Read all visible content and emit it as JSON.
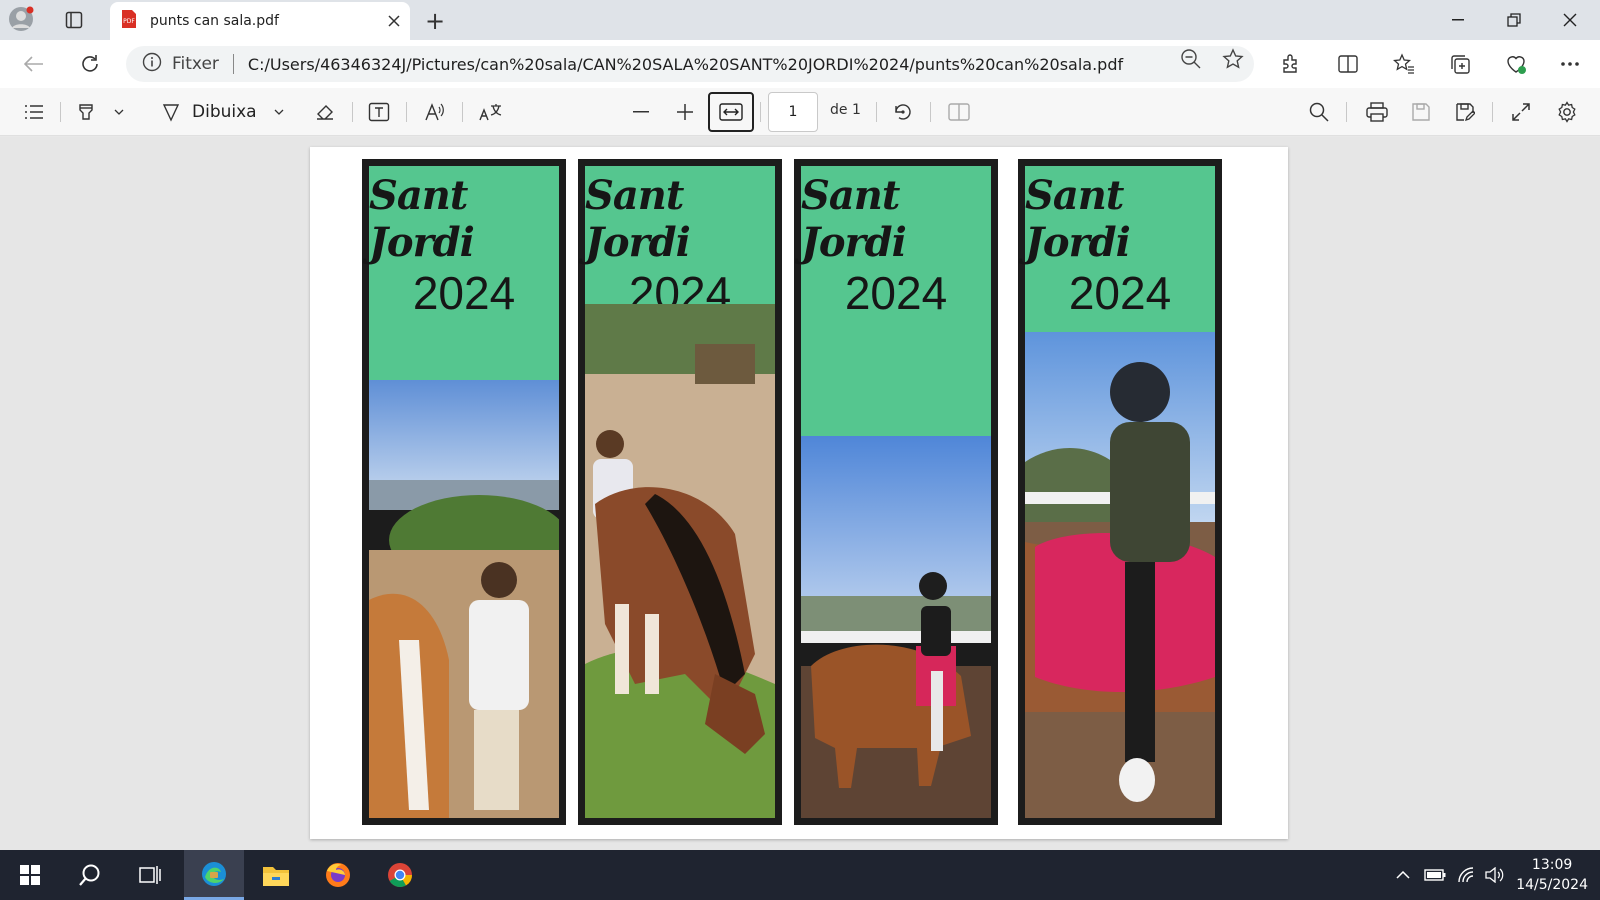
{
  "browser": {
    "tab_title": "punts can sala.pdf",
    "address_label": "Fitxer",
    "url": "C:/Users/46346324J/Pictures/can%20sala/CAN%20SALA%20SANT%20JORDI%2024/punts%20can%20sala.pdf"
  },
  "pdf_toolbar": {
    "draw_label": "Dibuixa",
    "page_number": "1",
    "page_of": "de 1"
  },
  "bookmarks": [
    {
      "title": "Sant Jordi",
      "year": "2024"
    },
    {
      "title": "Sant Jordi",
      "year": "2024"
    },
    {
      "title": "Sant Jordi",
      "year": "2024"
    },
    {
      "title": "Sant Jordi",
      "year": "2024"
    }
  ],
  "taskbar": {
    "time": "13:09",
    "date": "14/5/2024"
  },
  "colors": {
    "bookmark_green": "#55c68f",
    "bookmark_border": "#1c1c1c",
    "taskbar": "#1f2430"
  }
}
